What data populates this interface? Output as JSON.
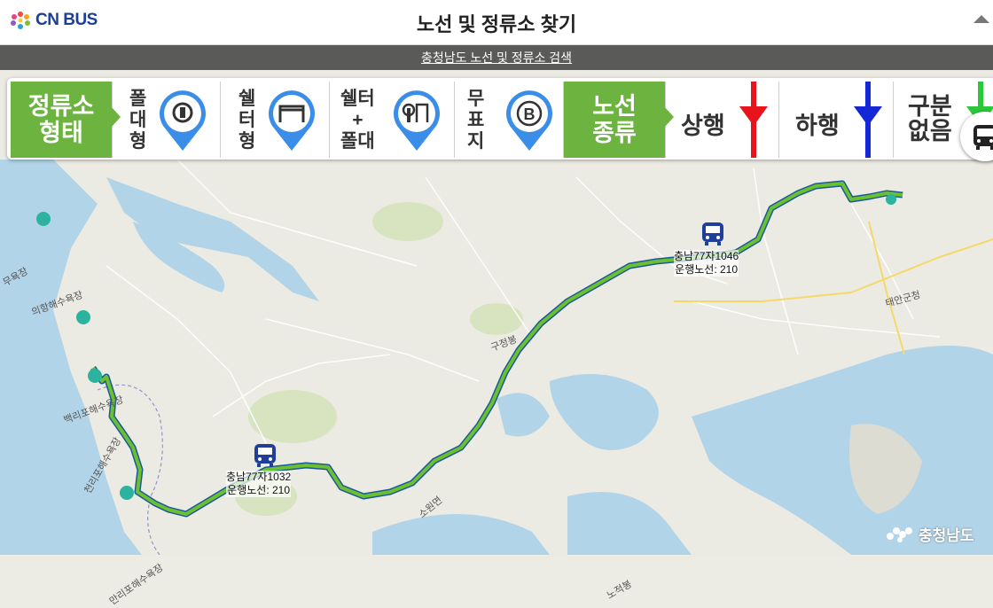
{
  "header": {
    "logo_text": "CN BUS",
    "title": "노선 및 정류소 찾기"
  },
  "subheader": {
    "search_link": "충청남도 노선 및 정류소 검색"
  },
  "legend": {
    "stop_type_title_line1": "정류소",
    "stop_type_title_line2": "형태",
    "pole_type": [
      "폴",
      "대",
      "형"
    ],
    "shelter_type": [
      "쉘",
      "터",
      "형"
    ],
    "shelter_pole": [
      "쉘터",
      "+",
      "폴대"
    ],
    "no_sign": [
      "무",
      "표",
      "지"
    ],
    "route_type_title_line1": "노선",
    "route_type_title_line2": "종류",
    "up_label": "상행",
    "down_label": "하행",
    "none_label_line1": "구분",
    "none_label_line2": "없음",
    "colors": {
      "green": "#6cb33f",
      "up": "#e8141b",
      "down": "#1428d8",
      "none": "#2bc93a",
      "pin": "#3b8ee8"
    }
  },
  "buses": [
    {
      "plate": "충남77자1046",
      "route": "운행노선: 210"
    },
    {
      "plate": "충남77자1032",
      "route": "운행노선: 210"
    }
  ],
  "map_labels": {
    "beach1": "의항해수욕장",
    "beach2": "백리포해수욕장",
    "beach3": "천리포해수욕장",
    "beach4": "만리포해수욕장",
    "place1": "구정봉",
    "place2": "소원면",
    "place3": "노적봉",
    "place4": "태안군청",
    "place5": "무욕장"
  },
  "watermark": "충청남도"
}
